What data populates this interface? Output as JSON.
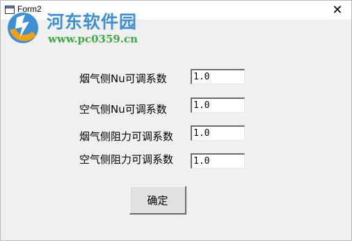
{
  "window": {
    "title": "Form2",
    "close_symbol": "✕"
  },
  "watermark": {
    "site_name": "河东软件园",
    "url": "www.pc0359.cn"
  },
  "form": {
    "fields": [
      {
        "label": "烟气侧Nu可调系数",
        "value": "1.0"
      },
      {
        "label": "空气侧Nu可调系数",
        "value": "1.0"
      },
      {
        "label": "烟气侧阻力可调系数",
        "value": "1.0"
      },
      {
        "label": "空气侧阻力可调系数",
        "value": "1.0"
      }
    ],
    "ok_label": "确定"
  },
  "colors": {
    "watermark_blue": "#3d8fd6",
    "watermark_green": "#3cab43",
    "background": "#f0f0f0"
  }
}
